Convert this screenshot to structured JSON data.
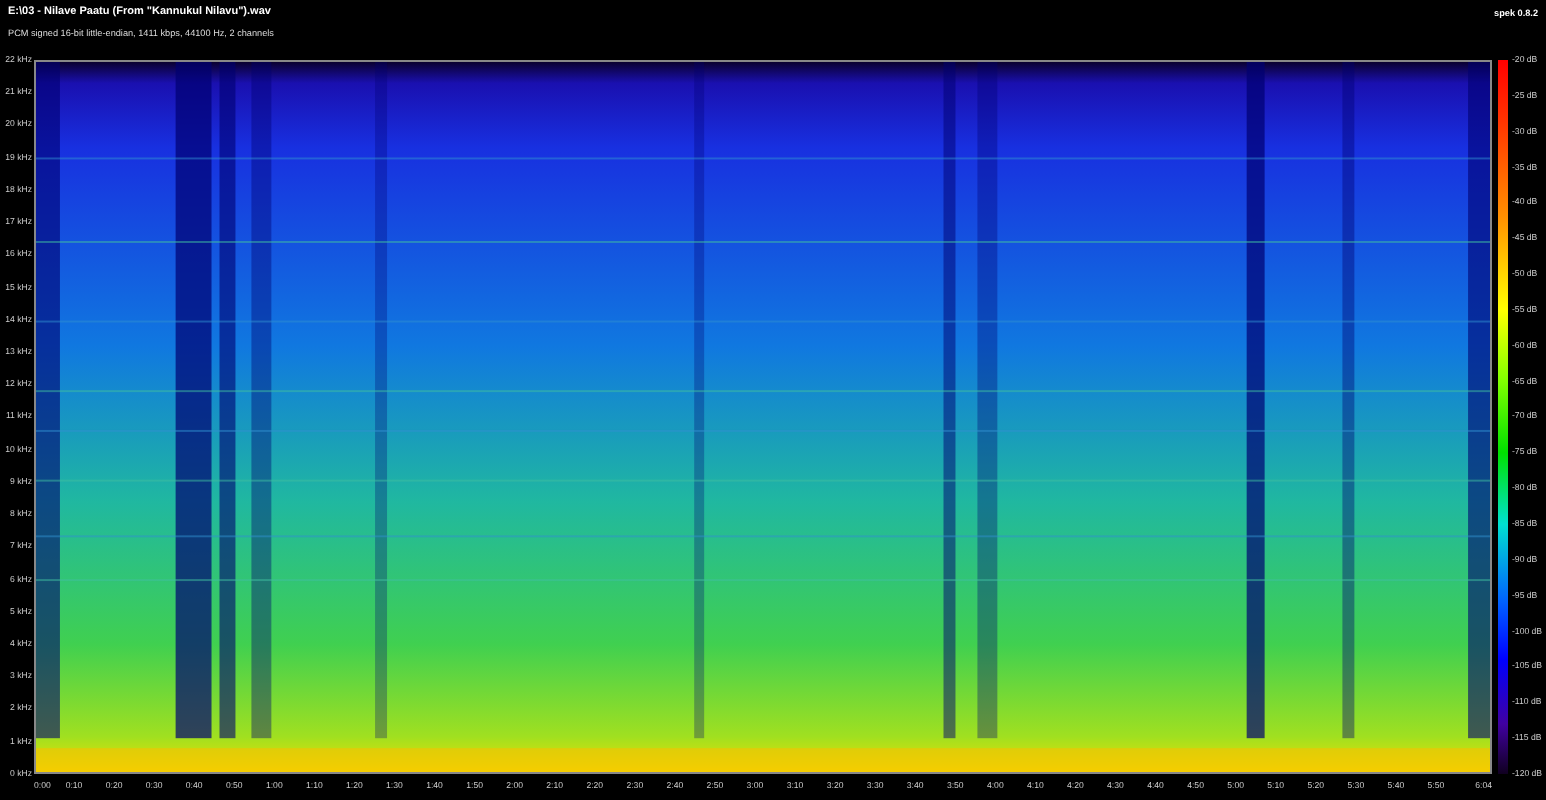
{
  "header": {
    "title": "E:\\03 - Nilave Paatu (From \"Kannukul Nilavu\").wav",
    "subtitle": "PCM signed 16-bit little-endian, 1411 kbps, 44100 Hz, 2 channels",
    "version": "spek 0.8.2"
  },
  "frequency_axis": {
    "labels": [
      "22 kHz",
      "21 kHz",
      "20 kHz",
      "19 kHz",
      "18 kHz",
      "17 kHz",
      "16 kHz",
      "15 kHz",
      "14 kHz",
      "13 kHz",
      "12 kHz",
      "11 kHz",
      "10 kHz",
      "9 kHz",
      "8 kHz",
      "7 kHz",
      "6 kHz",
      "5 kHz",
      "4 kHz",
      "3 kHz",
      "2 kHz",
      "1 kHz",
      "0 kHz"
    ]
  },
  "time_axis": {
    "labels": [
      "0:00",
      "0:10",
      "0:20",
      "0:30",
      "0:40",
      "0:50",
      "1:00",
      "1:10",
      "1:20",
      "1:30",
      "1:40",
      "1:50",
      "2:00",
      "2:10",
      "2:20",
      "2:30",
      "2:40",
      "2:50",
      "3:00",
      "3:10",
      "3:20",
      "3:30",
      "3:40",
      "3:50",
      "4:00",
      "4:10",
      "4:20",
      "4:30",
      "4:40",
      "4:50",
      "5:00",
      "5:10",
      "5:20",
      "5:30",
      "5:40",
      "5:50",
      "6:04"
    ]
  },
  "colorbar": {
    "labels": [
      "-20 dB",
      "-25 dB",
      "-30 dB",
      "-35 dB",
      "-40 dB",
      "-45 dB",
      "-50 dB",
      "-55 dB",
      "-60 dB",
      "-65 dB",
      "-70 dB",
      "-75 dB",
      "-80 dB",
      "-85 dB",
      "-90 dB",
      "-95 dB",
      "-100 dB",
      "-105 dB",
      "-110 dB",
      "-115 dB",
      "-120 dB"
    ]
  }
}
